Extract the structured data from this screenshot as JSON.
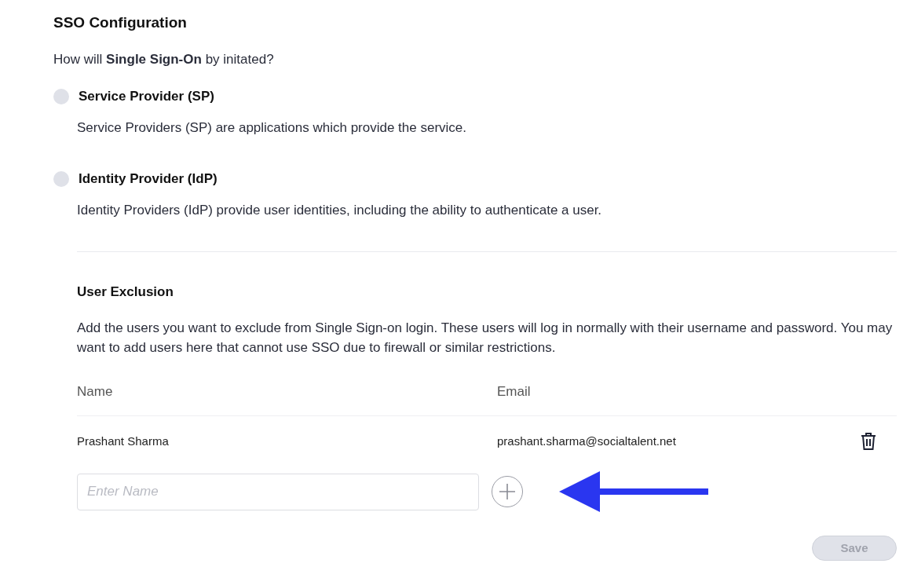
{
  "title": "SSO Configuration",
  "question": "How will **Single Sign-On** by initated?",
  "options": [
    {
      "label": "Service Provider (SP)",
      "description": "Service Providers (SP) are applications which provide the service.",
      "selected": false
    },
    {
      "label": "Identity Provider (IdP)",
      "description": "Identity Providers (IdP) provide user identities, including the ability to authenticate a user.",
      "selected": false
    }
  ],
  "exclusion": {
    "title": "User Exclusion",
    "description": "Add the users you want to exclude from Single Sign-on login. These users will log in normally with their username and password. You may want to add users here that cannot use SSO due to firewall or similar restrictions.",
    "columns": [
      "Name",
      "Email"
    ],
    "rows": [
      {
        "name": "Prashant Sharma",
        "email": "prashant.sharma@socialtalent.net"
      }
    ],
    "name_field": {
      "placeholder": "Enter Name"
    }
  },
  "save_button": {
    "label": "Save",
    "disabled": true
  }
}
